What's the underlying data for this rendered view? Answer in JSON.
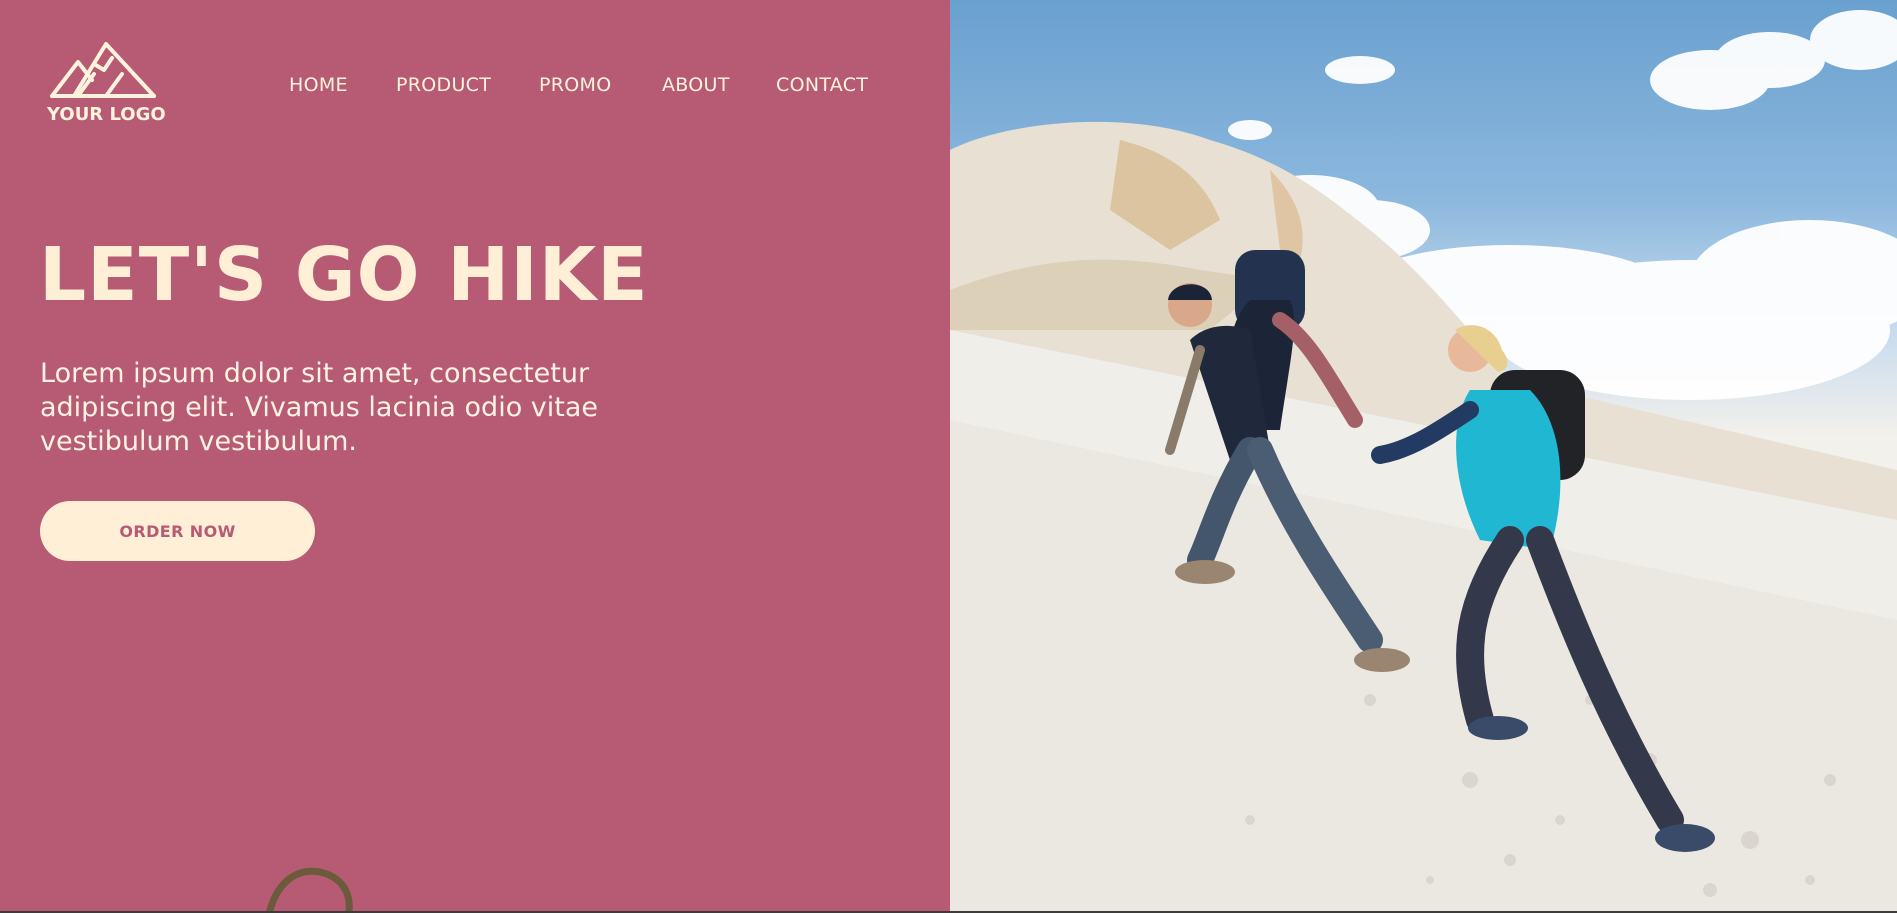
{
  "logo": {
    "text": "YOUR LOGO",
    "icon": "mountain-icon"
  },
  "nav": {
    "items": [
      {
        "label": "HOME"
      },
      {
        "label": "PRODUCT"
      },
      {
        "label": "PROMO"
      },
      {
        "label": "ABOUT"
      },
      {
        "label": "CONTACT"
      }
    ]
  },
  "hero": {
    "title": "LET'S GO HIKE",
    "description": "Lorem ipsum dolor sit amet, consectetur adipiscing elit. Vivamus lacinia odio vitae vestibulum vestibulum.",
    "cta_label": "ORDER NOW"
  },
  "photo": {
    "subject": "hikers-photo"
  },
  "colors": {
    "panel": "#b75a73",
    "cream": "#ffefd6",
    "accent_text": "#b75a73"
  }
}
